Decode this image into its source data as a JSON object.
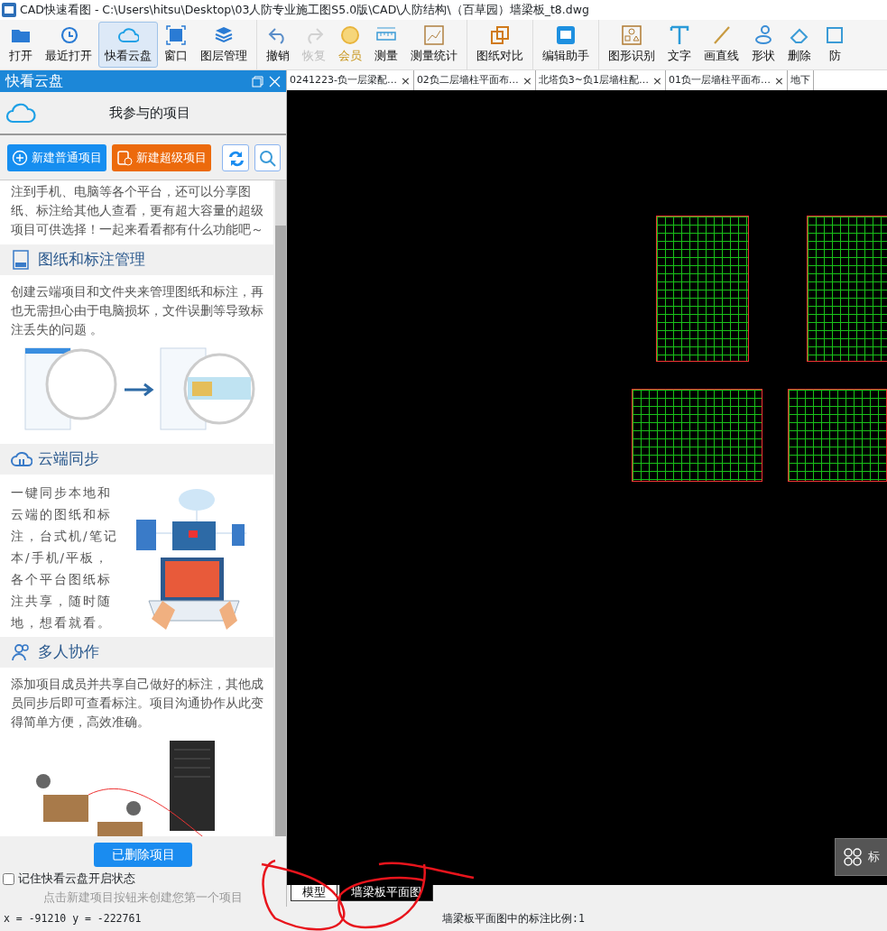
{
  "window": {
    "title": "CAD快速看图 - C:\\Users\\hitsu\\Desktop\\03人防专业施工图S5.0版\\CAD\\人防结构\\（百草园）墙梁板_t8.dwg"
  },
  "toolbar": {
    "groups": [
      [
        {
          "label": "打开",
          "selected": false,
          "disabled": false
        },
        {
          "label": "最近打开",
          "selected": false,
          "disabled": false
        },
        {
          "label": "快看云盘",
          "selected": true,
          "disabled": false
        },
        {
          "label": "窗口",
          "selected": false,
          "disabled": false
        },
        {
          "label": "图层管理",
          "selected": false,
          "disabled": false
        }
      ],
      [
        {
          "label": "撤销",
          "selected": false,
          "disabled": false
        },
        {
          "label": "恢复",
          "selected": false,
          "disabled": true
        },
        {
          "label": "会员",
          "selected": false,
          "disabled": false,
          "kind": "vip"
        },
        {
          "label": "测量",
          "selected": false,
          "disabled": false
        },
        {
          "label": "测量统计",
          "selected": false,
          "disabled": false
        }
      ],
      [
        {
          "label": "图纸对比",
          "selected": false,
          "disabled": false
        }
      ],
      [
        {
          "label": "编辑助手",
          "selected": false,
          "disabled": false
        }
      ],
      [
        {
          "label": "图形识别",
          "selected": false,
          "disabled": false
        },
        {
          "label": "文字",
          "selected": false,
          "disabled": false
        },
        {
          "label": "画直线",
          "selected": false,
          "disabled": false
        },
        {
          "label": "形状",
          "selected": false,
          "disabled": false
        },
        {
          "label": "删除",
          "selected": false,
          "disabled": false
        },
        {
          "label": "防",
          "selected": false,
          "disabled": false
        }
      ]
    ]
  },
  "cloud_panel": {
    "title": "快看云盘",
    "heading": "我参与的项目",
    "buttons": [
      {
        "label": "新建普通项目",
        "kind": "primary"
      },
      {
        "label": "新建超级项目",
        "kind": "super"
      }
    ],
    "intro": "注到手机、电脑等各个平台，还可以分享图纸、标注给其他人查看，更有超大容量的超级项目可供选择！一起来看看都有什么功能吧～",
    "sections": [
      {
        "title": "图纸和标注管理",
        "kind": "manage",
        "text": "创建云端项目和文件夹来管理图纸和标注，再也无需担心由于电脑损坏，文件误删等导致标注丢失的问题 。"
      },
      {
        "title": "云端同步",
        "kind": "sync",
        "text": "一键同步本地和云端的图纸和标注，台式机/笔记本/手机/平板，各个平台图纸标注共享，随时随地，想看就看。"
      },
      {
        "title": "多人协作",
        "kind": "team",
        "text": "添加项目成员并共享自己做好的标注，其他成员同步后即可查看标注。项目沟通协作从此变得简单方便，高效准确。"
      }
    ],
    "deleted_button": "已删除项目",
    "remember": {
      "label": "记住快看云盘开启状态",
      "checked": false
    },
    "hint": "点击新建项目按钮来创建您第一个项目"
  },
  "doc_tabs": [
    {
      "label": "0241223-负一层梁配…",
      "close": "×"
    },
    {
      "label": "02负二层墙柱平面布…",
      "close": "×"
    },
    {
      "label": "北塔负3~负1层墙柱配…",
      "close": "×"
    },
    {
      "label": "01负一层墙柱平面布…",
      "close": "×"
    },
    {
      "label": "地下"
    }
  ],
  "annotation_widget": {
    "label": "标"
  },
  "sheet_tabs": [
    {
      "label": "模型",
      "selected": true
    },
    {
      "label": "墙梁板平面图",
      "selected": false
    }
  ],
  "status_bar": {
    "coordinates": "x = -91210 y = -222761",
    "scale": "墙梁板平面图中的标注比例:1"
  }
}
